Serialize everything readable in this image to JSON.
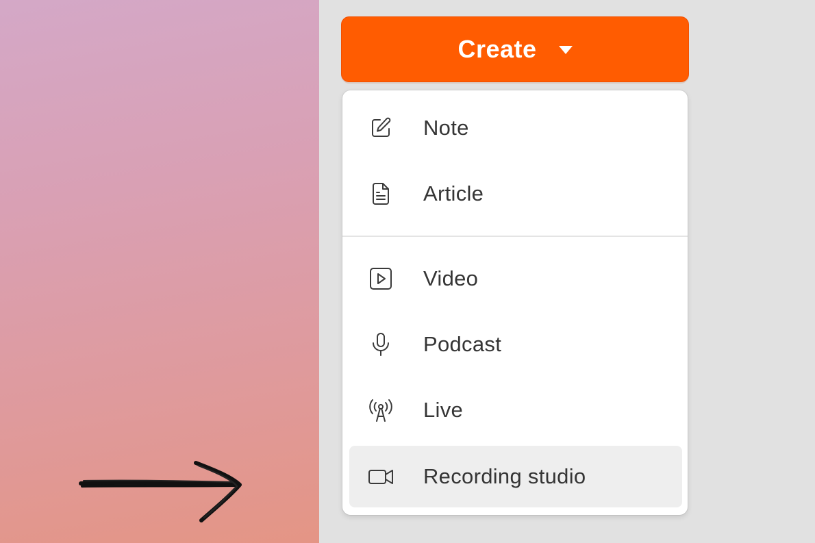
{
  "create_button": {
    "label": "Create",
    "color": "#ff5c01"
  },
  "menu": {
    "items": [
      {
        "label": "Note",
        "icon": "edit-note-icon"
      },
      {
        "label": "Article",
        "icon": "document-icon"
      },
      {
        "label": "Video",
        "icon": "play-video-icon"
      },
      {
        "label": "Podcast",
        "icon": "microphone-icon"
      },
      {
        "label": "Live",
        "icon": "broadcast-tower-icon"
      },
      {
        "label": "Recording studio",
        "icon": "video-camera-icon",
        "highlighted": true
      }
    ]
  }
}
